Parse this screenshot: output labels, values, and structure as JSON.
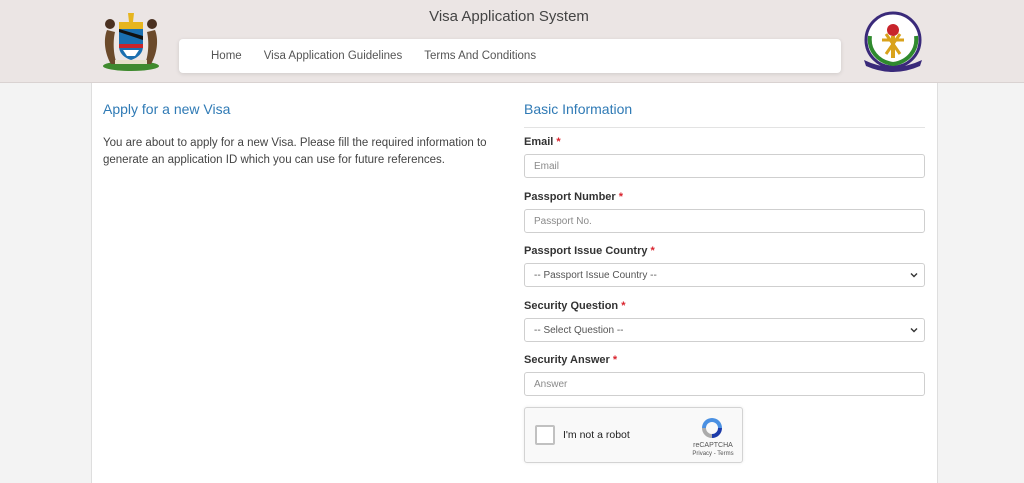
{
  "header": {
    "title": "Visa Application System",
    "nav": [
      "Home",
      "Visa Application Guidelines",
      "Terms And Conditions"
    ]
  },
  "left": {
    "title": "Apply for a new Visa",
    "text": "You are about to apply for a new Visa. Please fill the required information to generate an application ID which you can use for future references."
  },
  "form": {
    "title": "Basic Information",
    "email_label": "Email",
    "email_placeholder": "Email",
    "passport_label": "Passport Number",
    "passport_placeholder": "Passport No.",
    "country_label": "Passport Issue Country",
    "country_value": "-- Passport Issue Country --",
    "question_label": "Security Question",
    "question_value": "-- Select Question --",
    "answer_label": "Security Answer",
    "answer_placeholder": "Answer",
    "required_mark": "*"
  },
  "captcha": {
    "label": "I'm not a robot",
    "brand": "reCAPTCHA",
    "links": "Privacy - Terms"
  },
  "colors": {
    "header_bg": "#ebe5e4",
    "accent_blue": "#2f7ab5",
    "required_red": "#d9232d"
  }
}
